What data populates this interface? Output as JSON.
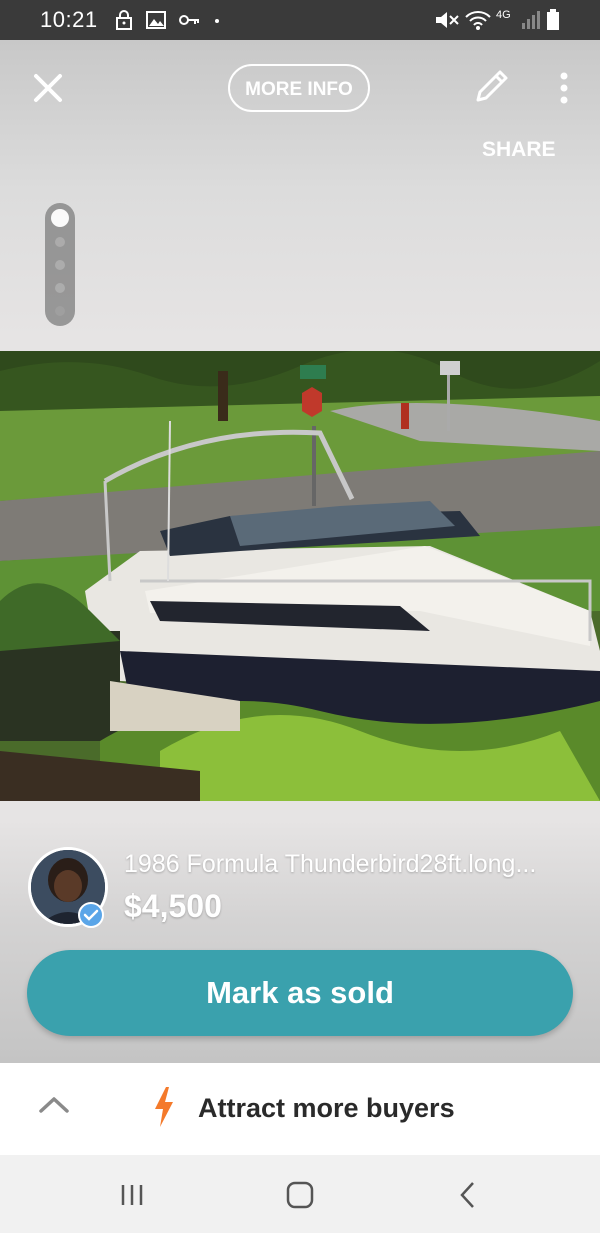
{
  "status_bar": {
    "time": "10:21",
    "network": "4G"
  },
  "toolbar": {
    "more_info_label": "MORE INFO",
    "share_label": "SHARE"
  },
  "gallery": {
    "photo_count": 5,
    "current_index": 1,
    "photo_description": "boat"
  },
  "listing": {
    "title": "1986 Formula Thunderbird28ft.long...",
    "price": "$4,500"
  },
  "actions": {
    "mark_sold_label": "Mark as sold"
  },
  "promo": {
    "label": "Attract more buyers"
  },
  "colors": {
    "accent": "#3aa1ad",
    "bolt": "#f47a2b",
    "status_bar": "#3a3a3a"
  },
  "icons": [
    "lock-icon",
    "image-icon",
    "key-icon",
    "mute-icon",
    "wifi-icon",
    "signal-icon",
    "battery-icon",
    "close-icon",
    "pencil-icon",
    "more-vert-icon",
    "verified-icon",
    "chevron-up-icon",
    "bolt-icon",
    "recents-icon",
    "home-icon",
    "back-icon"
  ]
}
